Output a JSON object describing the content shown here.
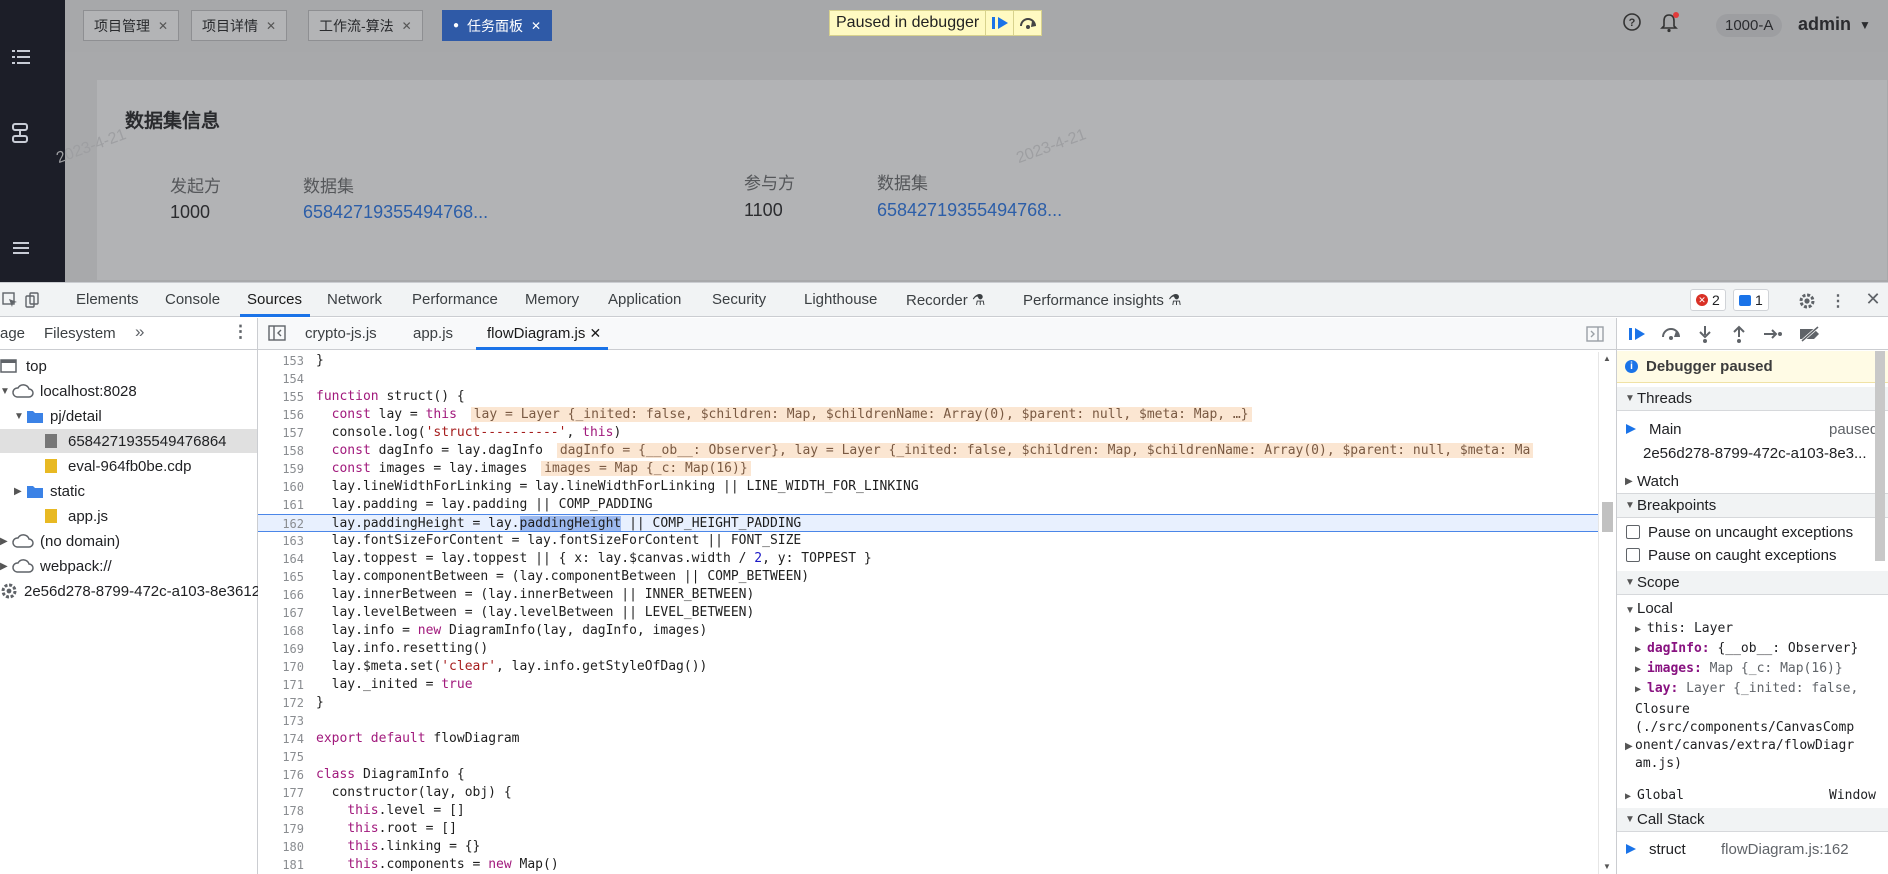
{
  "app": {
    "tabs": [
      "项目管理",
      "项目详情",
      "工作流-算法",
      "任务面板"
    ],
    "active_tab_index": 3,
    "paused_label": "Paused in debugger",
    "org_badge": "1000-A",
    "user": "admin",
    "card_title": "数据集信息",
    "initiator_label": "发起方",
    "initiator_value": "1000",
    "dataset_label_1": "数据集",
    "dataset_value_1": "65842719355494768...",
    "participant_label": "参与方",
    "participant_value": "1100",
    "dataset_label_2": "数据集",
    "dataset_value_2": "65842719355494768...",
    "watermark_1": "2023-4-21",
    "watermark_2": "2023-4-21"
  },
  "devtools": {
    "tabs": [
      "Elements",
      "Console",
      "Sources",
      "Network",
      "Performance",
      "Memory",
      "Application",
      "Security",
      "Lighthouse",
      "Recorder ⚗",
      "Performance insights ⚗"
    ],
    "active_tab": "Sources",
    "error_count": "2",
    "message_count": "1",
    "nav_tabs": [
      "age",
      "Filesystem"
    ],
    "tree": [
      "top",
      "localhost:8028",
      "pj/detail",
      "6584271935549476864",
      "eval-964fb0be.cdp",
      "static",
      "app.js",
      "(no domain)",
      "webpack://",
      "2e56d278-8799-472c-a103-8e3612"
    ],
    "editor_tabs": [
      "crypto-js.js",
      "app.js",
      "flowDiagram.js"
    ],
    "active_editor_tab": "flowDiagram.js",
    "line_numbers": [
      "153",
      "154",
      "155",
      "156",
      "157",
      "158",
      "159",
      "160",
      "161",
      "162",
      "163",
      "164",
      "165",
      "166",
      "167",
      "168",
      "169",
      "170",
      "171",
      "172",
      "173",
      "174",
      "175",
      "176",
      "177",
      "178",
      "179",
      "180",
      "181"
    ],
    "highlight_line": "162",
    "debugger_paused": "Debugger paused",
    "sections": {
      "threads": "Threads",
      "watch": "Watch",
      "breakpoints": "Breakpoints",
      "scope": "Scope",
      "call_stack": "Call Stack"
    },
    "thread_main": "Main",
    "thread_status": "paused",
    "thread_id": "2e56d278-8799-472c-a103-8e3...",
    "pause_uncaught": "Pause on uncaught exceptions",
    "pause_caught": "Pause on caught exceptions",
    "scope_local": "Local",
    "scope_this": "this: Layer",
    "scope_daginfo_key": "dagInfo:",
    "scope_daginfo_val": "{__ob__: Observer}",
    "scope_images_key": "images:",
    "scope_images_val": "Map {_c: Map(16)}",
    "scope_lay_key": "lay:",
    "scope_lay_val": "Layer {_inited: false,",
    "scope_closure_1": "Closure",
    "scope_closure_2": "(./src/components/CanvasComp",
    "scope_closure_3": "onent/canvas/extra/flowDiagr",
    "scope_closure_4": "am.js)",
    "scope_global": "Global",
    "scope_global_val": "Window",
    "stack_fn": "struct",
    "stack_loc": "flowDiagram.js:162"
  }
}
